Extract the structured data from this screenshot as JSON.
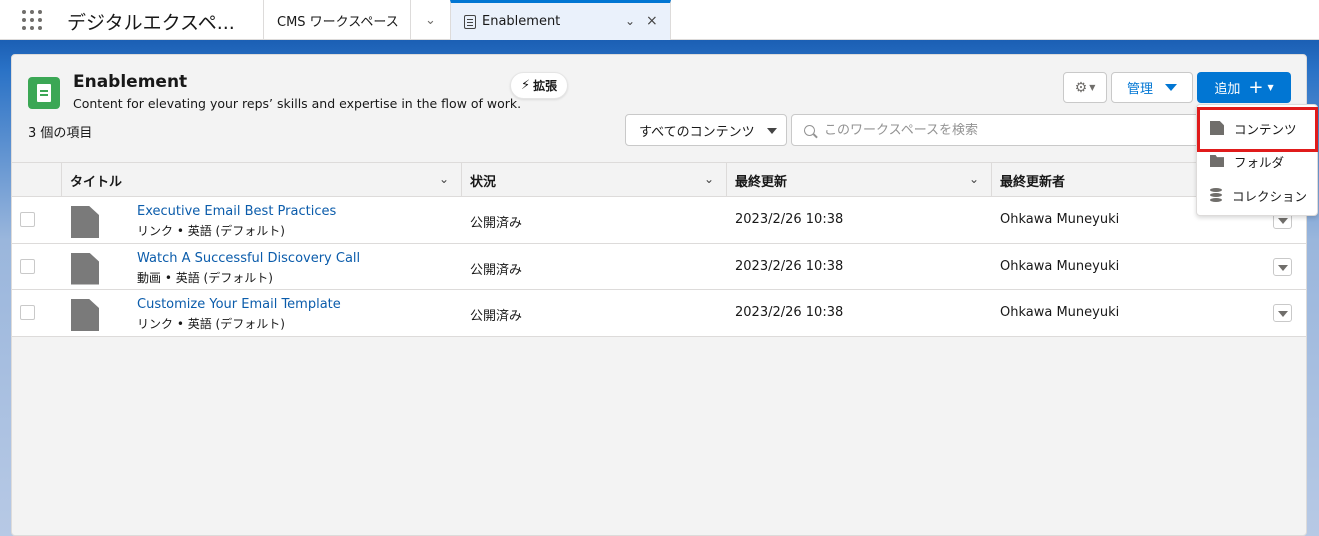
{
  "topnav": {
    "app_name": "デジタルエクスペ...",
    "tabs": [
      {
        "label": "CMS ワークスペース"
      },
      {
        "label": "Enablement"
      }
    ]
  },
  "header": {
    "title": "Enablement",
    "description": "Content for elevating your reps’ skills and expertise in the flow of work.",
    "item_count": "3 個の項目",
    "extend_label": "拡張",
    "manage_label": "管理",
    "add_label": "追加"
  },
  "filter": {
    "selected": "すべてのコンテンツ",
    "search_placeholder": "このワークスペースを検索"
  },
  "table": {
    "columns": [
      "タイトル",
      "状況",
      "最終更新",
      "最終更新者"
    ],
    "rows": [
      {
        "title": "Executive Email Best Practices",
        "subtitle": "リンク • 英語 (デフォルト)",
        "status": "公開済み",
        "updated": "2023/2/26 10:38",
        "updated_by": "Ohkawa Muneyuki"
      },
      {
        "title": "Watch A Successful Discovery Call",
        "subtitle": "動画 • 英語 (デフォルト)",
        "status": "公開済み",
        "updated": "2023/2/26 10:38",
        "updated_by": "Ohkawa Muneyuki"
      },
      {
        "title": "Customize Your Email Template",
        "subtitle": "リンク • 英語 (デフォルト)",
        "status": "公開済み",
        "updated": "2023/2/26 10:38",
        "updated_by": "Ohkawa Muneyuki"
      }
    ]
  },
  "add_menu": {
    "items": [
      {
        "label": "コンテンツ",
        "icon": "content-icon"
      },
      {
        "label": "フォルダ",
        "icon": "folder-icon"
      },
      {
        "label": "コレクション",
        "icon": "collection-icon"
      }
    ]
  },
  "colors": {
    "brand": "#0176d3",
    "header_icon": "#3ba755",
    "link": "#0b5cab",
    "highlight": "#e01b1b"
  }
}
